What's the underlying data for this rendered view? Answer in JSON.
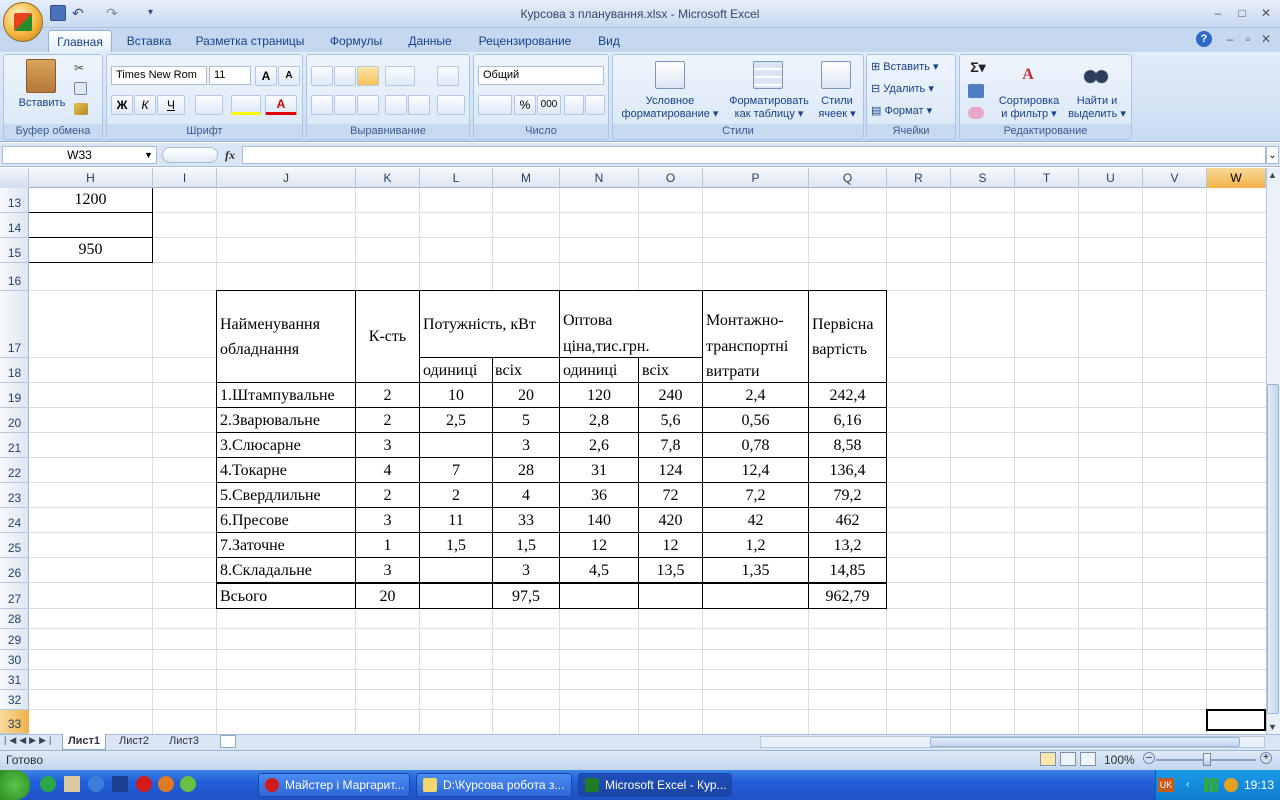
{
  "window": {
    "title": "Курсова з планування.xlsx - Microsoft Excel"
  },
  "tabs": [
    "Главная",
    "Вставка",
    "Разметка страницы",
    "Формулы",
    "Данные",
    "Рецензирование",
    "Вид"
  ],
  "ribbon": {
    "clipboard": {
      "label": "Буфер обмена",
      "paste": "Вставить"
    },
    "font": {
      "label": "Шрифт",
      "font_name": "Times New Rom",
      "font_size": "11"
    },
    "alignment": {
      "label": "Выравнивание"
    },
    "number": {
      "label": "Число",
      "format": "Общий",
      "percent": "%",
      "thousands": "000"
    },
    "styles": {
      "label": "Стили",
      "cond_format_1": "Условное",
      "cond_format_2": "форматирование",
      "format_table_1": "Форматировать",
      "format_table_2": "как таблицу",
      "cell_styles_1": "Стили",
      "cell_styles_2": "ячеек"
    },
    "cells": {
      "label": "Ячейки",
      "insert": "Вставить",
      "delete": "Удалить",
      "format": "Формат"
    },
    "editing": {
      "label": "Редактирование",
      "sort_1": "Сортировка",
      "sort_2": "и фильтр",
      "find_1": "Найти и",
      "find_2": "выделить"
    }
  },
  "formula_bar": {
    "name_box": "W33",
    "fx": "fx",
    "value": ""
  },
  "columns": [
    "H",
    "I",
    "J",
    "K",
    "L",
    "M",
    "N",
    "O",
    "P",
    "Q",
    "R",
    "S",
    "T",
    "U",
    "V",
    "W"
  ],
  "rows": [
    "13",
    "14",
    "15",
    "16",
    "17",
    "18",
    "19",
    "20",
    "21",
    "22",
    "23",
    "24",
    "25",
    "26",
    "27",
    "28",
    "29",
    "30",
    "31",
    "32",
    "33"
  ],
  "h_values": {
    "r13": "1200",
    "r15": "950"
  },
  "table": {
    "headers": {
      "name_1": "Найменування",
      "name_2": "обладнання",
      "qty": "К-сть",
      "power": "Потужність, кВт",
      "price_1": "Оптова",
      "price_2": "ціна,тис.грн.",
      "transport_1": "Монтажно-",
      "transport_2": "транспортні",
      "transport_3": "витрати",
      "initial_1": "Первісна",
      "initial_2": "вартість",
      "unit": "одиниці",
      "all": "всіх"
    },
    "rows": [
      {
        "name": "1.Штампувальне",
        "qty": "2",
        "p_unit": "10",
        "p_all": "20",
        "c_unit": "120",
        "c_all": "240",
        "transport": "2,4",
        "initial": "242,4"
      },
      {
        "name": "2.Зварювальне",
        "qty": "2",
        "p_unit": "2,5",
        "p_all": "5",
        "c_unit": "2,8",
        "c_all": "5,6",
        "transport": "0,56",
        "initial": "6,16"
      },
      {
        "name": "3.Слюсарне",
        "qty": "3",
        "p_unit": "",
        "p_all": "3",
        "c_unit": "2,6",
        "c_all": "7,8",
        "transport": "0,78",
        "initial": "8,58"
      },
      {
        "name": "4.Токарне",
        "qty": "4",
        "p_unit": "7",
        "p_all": "28",
        "c_unit": "31",
        "c_all": "124",
        "transport": "12,4",
        "initial": "136,4"
      },
      {
        "name": "5.Свердлильне",
        "qty": "2",
        "p_unit": "2",
        "p_all": "4",
        "c_unit": "36",
        "c_all": "72",
        "transport": "7,2",
        "initial": "79,2"
      },
      {
        "name": "6.Пресове",
        "qty": "3",
        "p_unit": "11",
        "p_all": "33",
        "c_unit": "140",
        "c_all": "420",
        "transport": "42",
        "initial": "462"
      },
      {
        "name": "7.Заточне",
        "qty": "1",
        "p_unit": "1,5",
        "p_all": "1,5",
        "c_unit": "12",
        "c_all": "12",
        "transport": "1,2",
        "initial": "13,2"
      },
      {
        "name": "8.Складальне",
        "qty": "3",
        "p_unit": "",
        "p_all": "3",
        "c_unit": "4,5",
        "c_all": "13,5",
        "transport": "1,35",
        "initial": "14,85"
      }
    ],
    "total": {
      "name": "Всього",
      "qty": "20",
      "p_unit": "",
      "p_all": "97,5",
      "c_unit": "",
      "c_all": "",
      "transport": "",
      "initial": "962,79"
    }
  },
  "sheets": [
    "Лист1",
    "Лист2",
    "Лист3"
  ],
  "status": {
    "text": "Готово",
    "zoom": "100%"
  },
  "taskbar": {
    "items": [
      "Майстер і Маргарит...",
      "D:\\Курсова робота з...",
      "Microsoft Excel - Кур..."
    ],
    "lang": "UK",
    "clock": "19:13"
  }
}
